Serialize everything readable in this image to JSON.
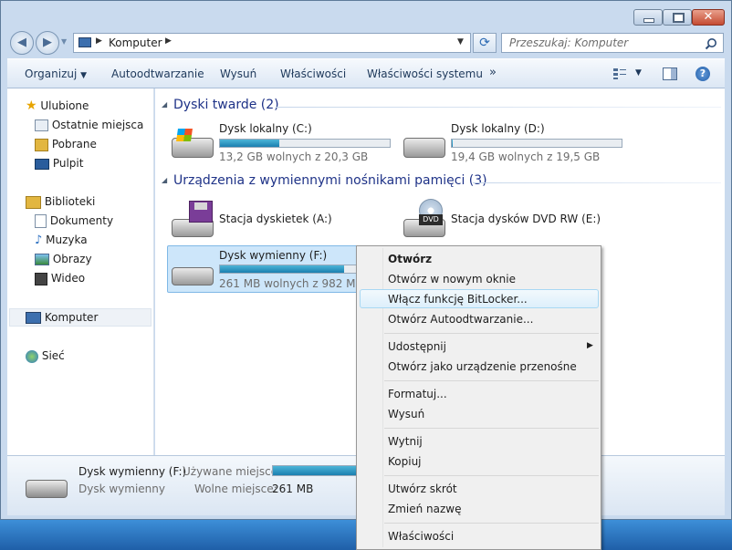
{
  "address": {
    "path": "Komputer"
  },
  "search": {
    "placeholder": "Przeszukaj: Komputer"
  },
  "toolbar": {
    "organize": "Organizuj",
    "autoplay": "Autoodtwarzanie",
    "eject": "Wysuń",
    "properties": "Właściwości",
    "system_properties": "Właściwości systemu",
    "more": "»"
  },
  "sidebar": {
    "favorites": "Ulubione",
    "recent": "Ostatnie miejsca",
    "downloads": "Pobrane",
    "desktop": "Pulpit",
    "libraries": "Biblioteki",
    "documents": "Dokumenty",
    "music": "Muzyka",
    "pictures": "Obrazy",
    "videos": "Wideo",
    "computer": "Komputer",
    "network": "Sieć"
  },
  "groups": {
    "hard_disks": "Dyski twarde (2)",
    "removable": "Urządzenia z wymiennymi nośnikami pamięci (3)"
  },
  "drives": {
    "c": {
      "name": "Dysk lokalny (C:)",
      "free": "13,2 GB wolnych z 20,3 GB",
      "used_fraction": 0.35
    },
    "d": {
      "name": "Dysk lokalny (D:)",
      "free": "19,4 GB wolnych z 19,5 GB",
      "used_fraction": 0.005
    },
    "a": {
      "name": "Stacja dyskietek (A:)"
    },
    "e": {
      "name": "Stacja dysków DVD RW (E:)"
    },
    "f": {
      "name": "Dysk wymienny (F:)",
      "free": "261 MB wolnych z 982 MB",
      "used_fraction": 0.73
    }
  },
  "details": {
    "name": "Dysk wymienny (F:)",
    "type": "Dysk wymienny",
    "used_label": "Używane miejsce:",
    "free_label": "Wolne miejsce:",
    "free_value": "261 MB"
  },
  "context_menu": {
    "open": "Otwórz",
    "open_new_window": "Otwórz w nowym oknie",
    "bitlocker": "Włącz funkcję BitLocker...",
    "open_autoplay": "Otwórz Autoodtwarzanie...",
    "share": "Udostępnij",
    "open_portable": "Otwórz jako urządzenie przenośne",
    "format": "Formatuj...",
    "eject": "Wysuń",
    "cut": "Wytnij",
    "copy": "Kopiuj",
    "create_shortcut": "Utwórz skrót",
    "rename": "Zmień nazwę",
    "properties": "Właściwości"
  },
  "colors": {
    "accent": "#1b7fb0",
    "group_header": "#1e3287",
    "selection": "#cde6fa"
  }
}
